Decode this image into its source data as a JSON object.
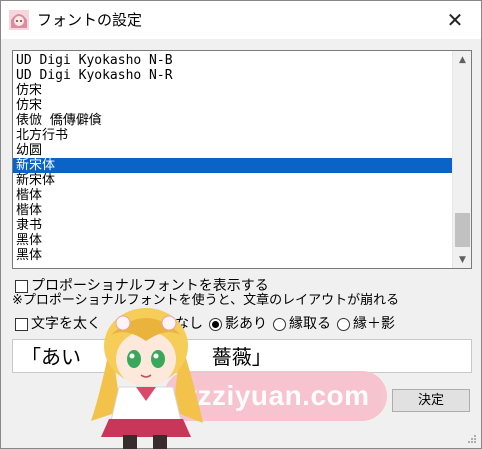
{
  "window": {
    "title": "フォントの設定",
    "icon": "anime-avatar-icon",
    "close_glyph": "✕"
  },
  "font_list": {
    "items": [
      "UD Digi Kyokasho N-B",
      "UD Digi Kyokasho N-R",
      "仿宋",
      "仿宋",
      "俵倣 僑傳僻僋",
      "北方行书",
      "幼圆",
      "新宋体",
      "新宋体",
      "楷体",
      "楷体",
      "隶书",
      "黑体",
      "黑体"
    ],
    "selected_index": 7,
    "scroll_up_glyph": "▲",
    "scroll_down_glyph": "▼"
  },
  "options": {
    "proportional_label": "プロポーショナルフォントを表示する",
    "proportional_note": "※プロポーショナルフォントを使うと、文章のレイアウトが崩れる",
    "bold_label": "文字を太く",
    "shadow_none_label": "なし",
    "shadow_on_label": "影あり",
    "outline_label": "縁取る",
    "outline_shadow_label": "縁＋影",
    "selected_effect": "影あり"
  },
  "preview": {
    "text": "「あい",
    "text_tail": "薔薇」"
  },
  "buttons": {
    "ok_label": "決定"
  },
  "watermark": {
    "text": "yzziyuan.com",
    "color": "#f7c0cc"
  },
  "colors": {
    "selection": "#0a64c8",
    "window_bg": "#f0f0f0"
  }
}
